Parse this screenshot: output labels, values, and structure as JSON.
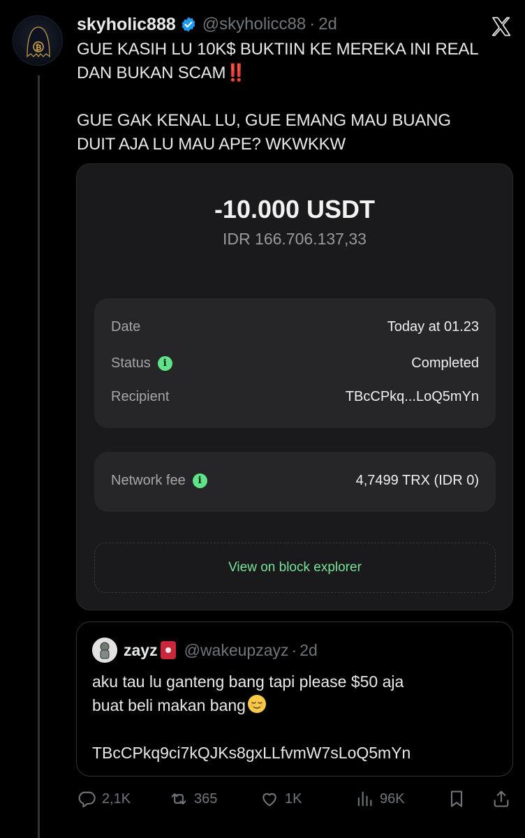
{
  "tweet": {
    "display_name": "skyholic888",
    "handle": "@skyholicc88",
    "separator": "·",
    "age": "2d",
    "text_line1": "GUE KASIH LU 10K$ BUKTIIN KE MEREKA INI REAL",
    "text_line2": "DAN BUKAN SCAM",
    "text_emphasis": "‼️",
    "text_para2": "GUE GAK KENAL LU, GUE EMANG MAU BUANG\nDUIT AJA LU MAU APE? WKWKKW"
  },
  "receipt": {
    "amount": "-10.000 USDT",
    "amount_idr": "IDR 166.706.137,33",
    "rows": [
      {
        "label": "Date",
        "value": "Today at 01.23"
      },
      {
        "label": "Status",
        "value": "Completed"
      },
      {
        "label": "Recipient",
        "value": "TBcCPkq...LoQ5mYn"
      }
    ],
    "fee_label": "Network fee",
    "fee_value": "4,7499 TRX (IDR 0)",
    "explorer_label": "View on block explorer",
    "accent_color": "#5fe28a"
  },
  "quote": {
    "display_name": "zayz",
    "handle": "@wakeupzayz",
    "separator": "·",
    "age": "2d",
    "text": "aku tau lu ganteng bang tapi please $50 aja\nbuat beli makan bang",
    "address": "TBcCPkq9ci7kQJKs8gxLLfvmW7sLoQ5mYn"
  },
  "actions": {
    "replies": "2,1K",
    "retweets": "365",
    "likes": "1K",
    "views": "96K"
  },
  "icons": [
    "bitcoin-avatar",
    "verified-badge-icon",
    "x-logo-icon",
    "info-icon",
    "reply-icon",
    "retweet-icon",
    "like-icon",
    "views-icon",
    "bookmark-icon",
    "share-icon"
  ]
}
